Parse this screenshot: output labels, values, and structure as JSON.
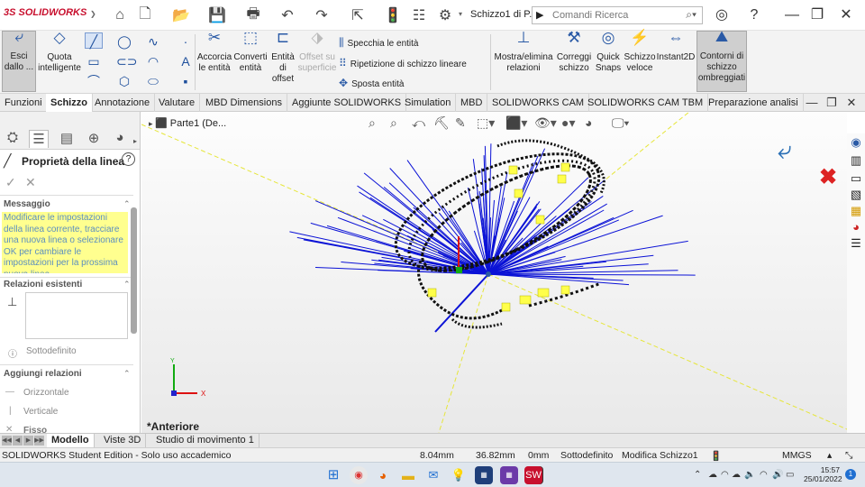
{
  "titlebar": {
    "brand": "SOLIDWORKS",
    "doc_title": "Schizzo1 di P...",
    "search_placeholder": "Comandi Ricerca"
  },
  "ribbon": {
    "exit_sketch": "Esci dallo ...",
    "smart_dimension": "Quota intelligente",
    "trim": "Accorcia le entità",
    "convert": "Converti entità",
    "offset": "Entità di offset",
    "surface_offset": "Offset su superficie",
    "mirror": "Specchia le entità",
    "pattern": "Ripetizione di schizzo lineare",
    "move": "Sposta entità",
    "relations": "Mostra/elimina relazioni",
    "repair": "Correggi schizzo",
    "quick_snaps": "Quick Snaps",
    "rapid_sketch": "Schizzo veloce",
    "instant2d": "Instant2D",
    "shaded_contours": "Contorni di schizzo ombreggiati"
  },
  "tabs": [
    {
      "label": "Funzioni"
    },
    {
      "label": "Schizzo"
    },
    {
      "label": "Annotazione"
    },
    {
      "label": "Valutare"
    },
    {
      "label": "MBD Dimensions"
    },
    {
      "label": "Aggiunte SOLIDWORKS"
    },
    {
      "label": "Simulation"
    },
    {
      "label": "MBD"
    },
    {
      "label": "SOLIDWORKS CAM"
    },
    {
      "label": "SOLIDWORKS CAM TBM"
    },
    {
      "label": "Preparazione analisi"
    }
  ],
  "panel": {
    "title": "Proprietà della linea",
    "message_header": "Messaggio",
    "message": "Modificare le impostazioni della linea corrente, tracciare una nuova linea o selezionare OK per cambiare le impostazioni per la prossima nuova linea.",
    "existing_relations": "Relazioni esistenti",
    "underdefined": "Sottodefinito",
    "add_relations": "Aggiungi relazioni",
    "horizontal": "Orizzontale",
    "vertical": "Verticale",
    "fix": "Fisso"
  },
  "viewport": {
    "tree_item": "Parte1  (De...",
    "orientation": "*Anteriore",
    "axis_x": "X",
    "axis_y": "Y"
  },
  "bottom_tabs": [
    {
      "label": "Modello"
    },
    {
      "label": "Viste 3D"
    },
    {
      "label": "Studio di movimento 1"
    }
  ],
  "status": {
    "edition": "SOLIDWORKS Student Edition - Solo uso accademico",
    "x": "8.04mm",
    "y": "36.82mm",
    "z": "0mm",
    "state": "Sottodefinito",
    "mode": "Modifica Schizzo1",
    "units": "MMGS"
  },
  "taskbar": {
    "time": "15:57",
    "date": "25/01/2022",
    "notifications": "1"
  },
  "colors": {
    "brand_red": "#c8102e",
    "sketch_blue": "#0b12d6",
    "highlight_yellow": "#ffff8f"
  }
}
